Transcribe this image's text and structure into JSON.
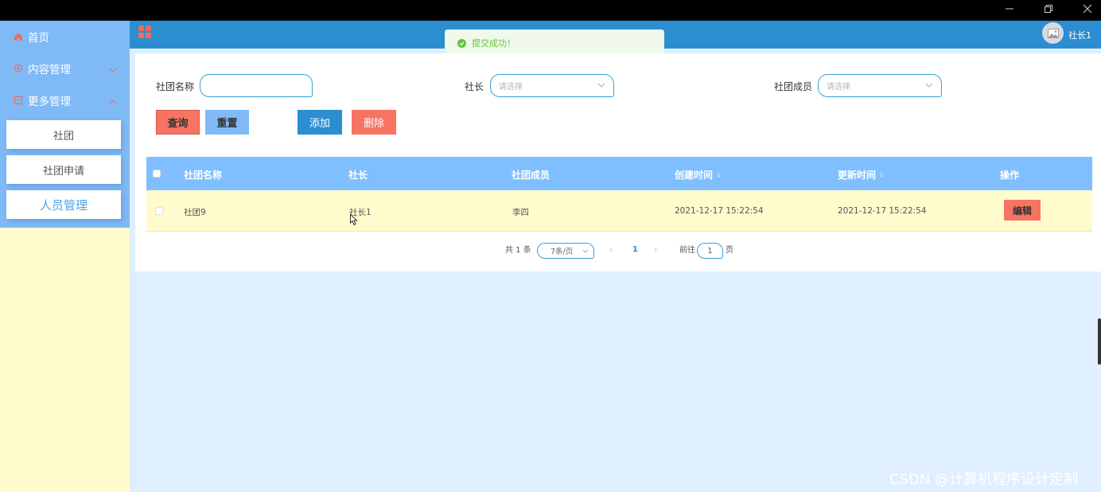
{
  "window": {
    "minimize_icon": "minimize-icon",
    "maximize_icon": "restore-icon",
    "close_icon": "close-icon"
  },
  "sidebar": {
    "menu": [
      {
        "label": "首页",
        "icon": "home-icon"
      },
      {
        "label": "内容管理",
        "icon": "content-icon"
      },
      {
        "label": "更多管理",
        "icon": "more-icon"
      }
    ],
    "submenu": [
      {
        "label": "社团"
      },
      {
        "label": "社团申请"
      },
      {
        "label": "人员管理"
      }
    ]
  },
  "header": {
    "user_name": "社长1"
  },
  "toast": {
    "message": "提交成功！"
  },
  "filters": {
    "club_name_label": "社团名称",
    "club_name_value": "",
    "leader_label": "社长",
    "leader_placeholder": "请选择",
    "members_label": "社团成员",
    "members_placeholder": "请选择"
  },
  "actions": {
    "query": "查询",
    "reset": "重置",
    "add": "添加",
    "delete": "删除"
  },
  "table": {
    "headers": [
      "社团名称",
      "社长",
      "社团成员",
      "创建时间",
      "更新时间",
      "操作"
    ],
    "rows": [
      {
        "name": "社团9",
        "leader": "社长1",
        "members": "李四",
        "created": "2021-12-17 15:22:54",
        "updated": "2021-12-17 15:22:54",
        "edit": "编辑"
      }
    ]
  },
  "pagination": {
    "total": "共 1 条",
    "page_size": "7条/页",
    "current_page": "1",
    "goto_label": "前往",
    "goto_value": "1",
    "page_unit": "页"
  },
  "watermark": "CSDN @计算机程序设计定制",
  "colors": {
    "sidebar_blue": "#7fbaf7",
    "header_blue": "#2b8ed1",
    "danger": "#f87362",
    "row_yellow": "#fffbcc",
    "page_bg": "#e0efff"
  }
}
